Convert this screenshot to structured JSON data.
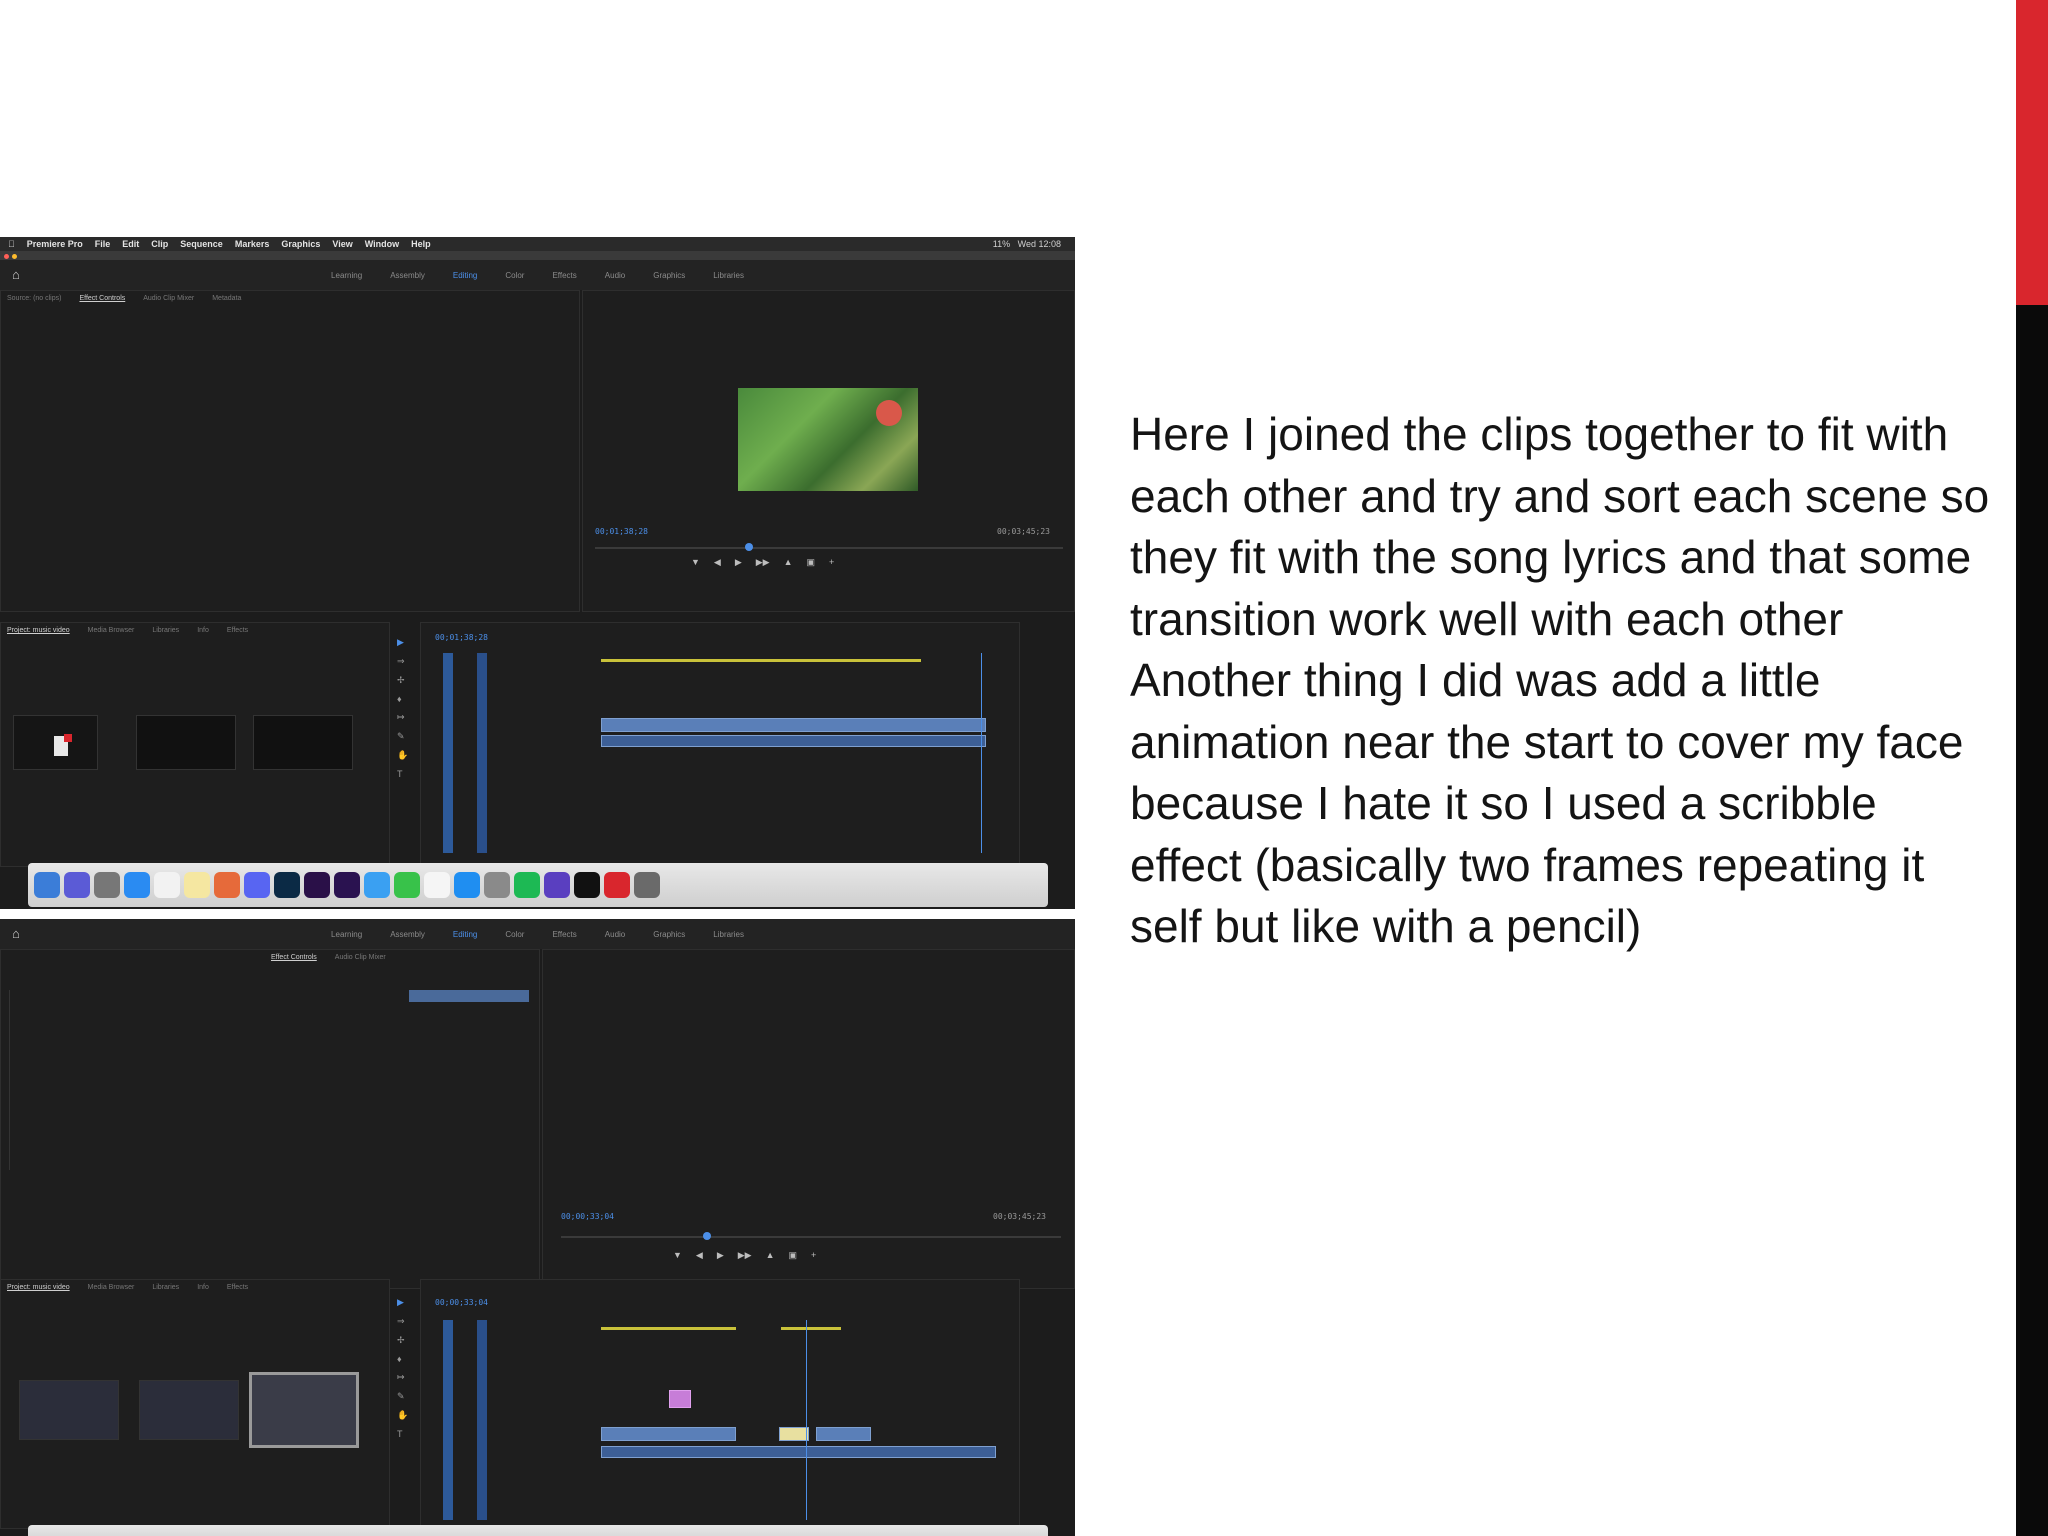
{
  "slide": {
    "paragraph1": "Here I joined the clips together to fit with each other and try and sort each scene so they fit with the song lyrics and that some transition work well with each other",
    "paragraph2": "Another thing I did was add a little animation near the start to cover my face because I hate it so I used a scribble effect (basically two frames repeating it self but like with a pencil)"
  },
  "colors": {
    "accent_red": "#d9262d",
    "accent_black": "#0a0a0a",
    "premiere_blue": "#4c8fe8"
  },
  "screenshot1": {
    "app_name": "Premiere Pro",
    "menu": [
      "File",
      "Edit",
      "Clip",
      "Sequence",
      "Markers",
      "Graphics",
      "View",
      "Window",
      "Help"
    ],
    "clock": "Wed 12:08",
    "battery": "11%",
    "workspaces": [
      "Learning",
      "Assembly",
      "Editing",
      "Color",
      "Effects",
      "Audio",
      "Graphics",
      "Libraries"
    ],
    "active_workspace": "Editing",
    "source_tabs": [
      "Source: (no clips)",
      "Effect Controls",
      "Audio Clip Mixer",
      "Metadata"
    ],
    "active_source_tab": "Effect Controls",
    "program_timecode": "00;01;38;28",
    "program_duration": "00;03;45;23",
    "project_tabs": [
      "Project: music video",
      "Media Browser",
      "Libraries",
      "Info",
      "Effects"
    ],
    "sequence_timecode": "00;01;38;28"
  },
  "screenshot2": {
    "workspaces": [
      "Learning",
      "Assembly",
      "Editing",
      "Color",
      "Effects",
      "Audio",
      "Graphics",
      "Libraries"
    ],
    "active_workspace": "Editing",
    "source_tabs": [
      "Effect Controls",
      "Audio Clip Mixer"
    ],
    "active_source_tab": "Effect Controls",
    "program_timecode": "00;00;33;04",
    "program_duration": "00;03;45;23",
    "project_tabs": [
      "Project: music video",
      "Media Browser",
      "Libraries",
      "Info",
      "Effects"
    ],
    "sequence_timecode": "00;00;33;04"
  }
}
